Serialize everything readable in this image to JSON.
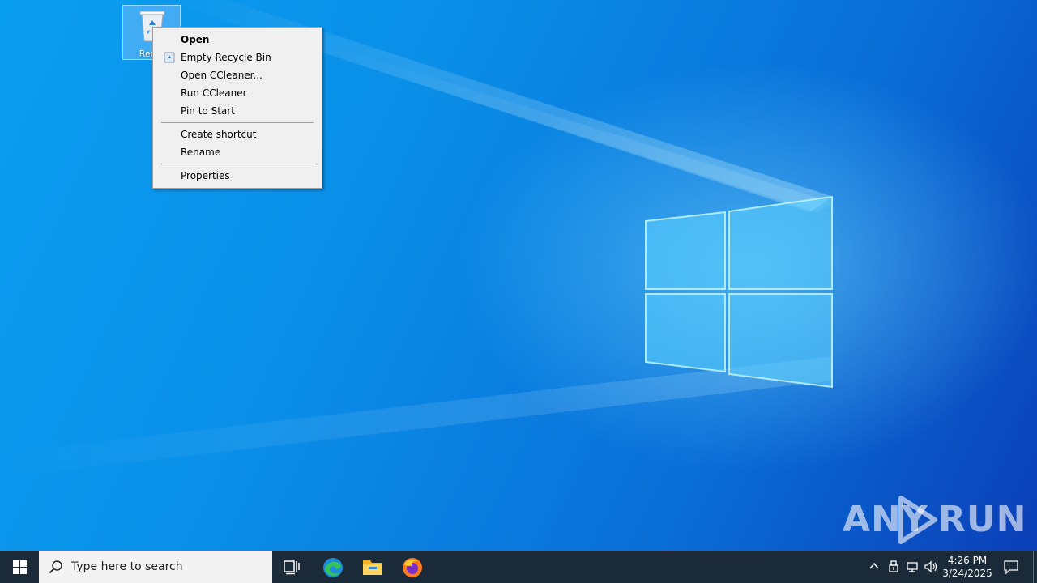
{
  "desktop": {
    "recycle_bin": {
      "label": "Recyc",
      "icon": "recycle-bin-icon"
    }
  },
  "context_menu": {
    "items": [
      {
        "label": "Open",
        "bold": true
      },
      {
        "label": "Empty Recycle Bin",
        "icon": "recycle-icon"
      },
      {
        "label": "Open CCleaner..."
      },
      {
        "label": "Run CCleaner"
      },
      {
        "label": "Pin to Start"
      },
      {
        "label": "Create shortcut"
      },
      {
        "label": "Rename"
      },
      {
        "label": "Properties"
      }
    ]
  },
  "taskbar": {
    "search_placeholder": "Type here to search",
    "apps": [
      "task-view-icon",
      "edge-icon",
      "file-explorer-icon",
      "firefox-icon"
    ],
    "clock": {
      "time": "4:26 PM",
      "date": "3/24/2025"
    }
  },
  "watermark": {
    "left": "ANY",
    "right": "RUN"
  },
  "colors": {
    "desktop_primary": "#0a8fe8",
    "taskbar": "#1b2a38",
    "menu_bg": "#f0f0f0"
  }
}
